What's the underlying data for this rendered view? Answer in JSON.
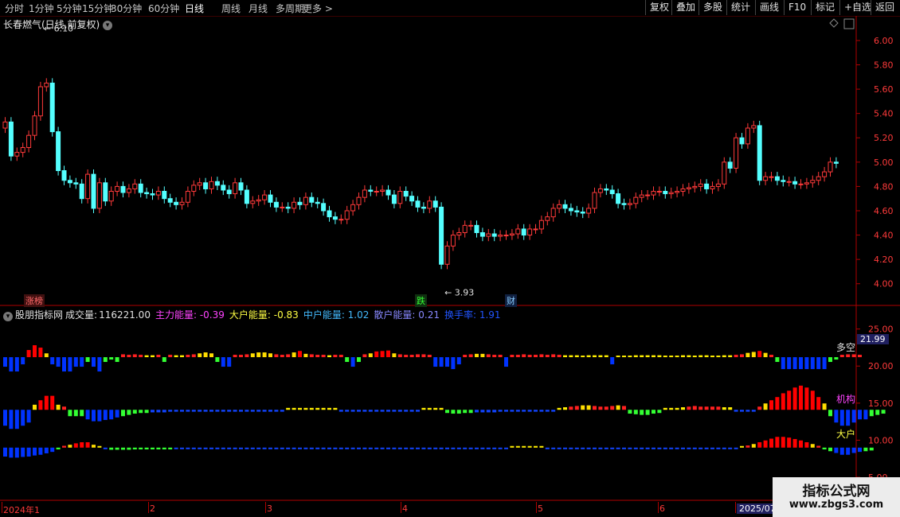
{
  "toolbar": {
    "timeframes": [
      "分时",
      "1分钟",
      "5分钟",
      "15分钟",
      "30分钟",
      "60分钟",
      "日线",
      "周线",
      "月线",
      "多周期",
      "更多 >"
    ],
    "active_timeframe": "日线",
    "buttons": [
      "复权",
      "叠加",
      "多股",
      "统计",
      "画线",
      "F10",
      "标记",
      "+自选",
      "返回"
    ]
  },
  "stock": {
    "title": "长春燃气(日线,前复权)",
    "high_label": "6.10",
    "low_label": "3.93"
  },
  "price_axis": [
    "6.00",
    "5.80",
    "5.60",
    "5.40",
    "5.20",
    "5.00",
    "4.80",
    "4.60",
    "4.40",
    "4.20",
    "4.00"
  ],
  "events": {
    "zhangbang": "涨榜",
    "die": "跌",
    "cai": "财"
  },
  "indicator": {
    "name": "股朋指标网",
    "volume_label": "成交量:",
    "volume_value": "116221.00",
    "main": "主力能量: -0.39",
    "big": "大户能量: -0.83",
    "mid": "中户能量: 1.02",
    "retail": "散户能量: 0.21",
    "turnover": "换手率: 1.91",
    "axis": [
      "25.00",
      "20.00",
      "15.00",
      "10.00",
      "5.00"
    ],
    "current_value": "21.99",
    "lines": {
      "duokong": "多空",
      "jigou": "机构",
      "dahu": "大户"
    }
  },
  "dates": [
    "2024年1",
    "2",
    "3",
    "4",
    "5",
    "6",
    "2025/07"
  ],
  "watermark": {
    "line1": "指标公式网",
    "line2": "www.zbgs3.com"
  },
  "colors": {
    "up": "#ff3a3a",
    "down": "#54ffff",
    "frame": "#b00000"
  },
  "chart_data": {
    "type": "candlestick",
    "price_range": [
      3.9,
      6.15
    ],
    "closes": [
      5.33,
      5.05,
      5.08,
      5.12,
      5.22,
      5.38,
      5.62,
      5.65,
      5.25,
      4.93,
      4.85,
      4.83,
      4.82,
      4.7,
      4.9,
      4.62,
      4.83,
      4.68,
      4.76,
      4.8,
      4.75,
      4.78,
      4.82,
      4.75,
      4.74,
      4.73,
      4.76,
      4.7,
      4.67,
      4.65,
      4.67,
      4.76,
      4.81,
      4.83,
      4.78,
      4.84,
      4.81,
      4.77,
      4.74,
      4.83,
      4.77,
      4.66,
      4.68,
      4.69,
      4.73,
      4.67,
      4.63,
      4.63,
      4.62,
      4.67,
      4.65,
      4.71,
      4.67,
      4.66,
      4.6,
      4.55,
      4.53,
      4.53,
      4.6,
      4.65,
      4.71,
      4.77,
      4.76,
      4.76,
      4.77,
      4.73,
      4.66,
      4.76,
      4.72,
      4.68,
      4.63,
      4.62,
      4.68,
      4.63,
      4.16,
      4.31,
      4.4,
      4.42,
      4.48,
      4.48,
      4.42,
      4.39,
      4.41,
      4.39,
      4.4,
      4.4,
      4.41,
      4.45,
      4.4,
      4.45,
      4.45,
      4.52,
      4.55,
      4.62,
      4.65,
      4.62,
      4.6,
      4.59,
      4.58,
      4.62,
      4.75,
      4.78,
      4.77,
      4.74,
      4.66,
      4.65,
      4.66,
      4.71,
      4.73,
      4.73,
      4.76,
      4.76,
      4.74,
      4.75,
      4.76,
      4.78,
      4.79,
      4.8,
      4.82,
      4.78,
      4.8,
      4.82,
      5.0,
      4.95,
      5.2,
      5.15,
      5.28,
      5.3,
      4.85,
      4.88,
      4.88,
      4.85,
      4.84,
      4.84,
      4.82,
      4.82,
      4.83,
      4.85,
      4.88,
      4.92,
      5.0,
      4.99
    ],
    "volume_bars": {
      "duokong": [
        -2,
        -3,
        -3,
        -1.5,
        1.5,
        2.5,
        2,
        0.8,
        -1.5,
        -2,
        -3,
        -3,
        -2,
        -2,
        -1,
        -2,
        -3,
        -1,
        -0.5,
        -1,
        0.6,
        0.5,
        0.6,
        0.5,
        0.4,
        0.4,
        0.5,
        -1,
        0.5,
        0.4,
        0.4,
        0.5,
        0.6,
        0.8,
        1,
        0.8,
        -1,
        -2,
        -2,
        0.5,
        0.5,
        0.6,
        0.8,
        1,
        1,
        0.8,
        0.6,
        0.5,
        0.6,
        1,
        1.3,
        0.7,
        0.6,
        0.5,
        0.5,
        0.4,
        0.5,
        0.5,
        -1,
        -2,
        -1,
        0.6,
        0.8,
        1.2,
        1.3,
        1.4,
        0.8,
        0.6,
        0.5,
        0.5,
        0.6,
        0.6,
        0.5,
        -2,
        -2,
        -2,
        -2.5,
        -1.5,
        0.5,
        0.6,
        0.7,
        0.7,
        0.6,
        0.5,
        0.5,
        -2,
        0.5,
        0.5,
        0.6,
        0.5,
        0.5,
        0.6,
        0.5,
        0.6,
        0.5,
        0.4,
        0.4,
        0.4,
        0.3,
        0.4,
        0.4,
        0.4,
        0.4,
        -1.5,
        0.3,
        0.3,
        0.3,
        0.4,
        0.4,
        0.4,
        0.4,
        0.4,
        0.3,
        0.3,
        0.3,
        0.4,
        0.4,
        0.3,
        0.4,
        0.4,
        0.3,
        0.3,
        0.4,
        0.4,
        0.5,
        0.6,
        0.9,
        1.1,
        1.3,
        0.9,
        0.5,
        -1,
        -2.5,
        -2.5,
        -2.5,
        -2.5,
        -2.5,
        -2.5,
        -2.5,
        -2.5,
        -1,
        -0.5,
        0.5,
        0.6,
        0.6,
        0.5
      ],
      "jigou": [
        -2.5,
        -3,
        -3,
        -2.5,
        -2,
        0.8,
        1.5,
        2.2,
        2.2,
        0.8,
        0.5,
        -1,
        -1,
        -1,
        -1.5,
        -1.8,
        -1.8,
        -1.6,
        -1.5,
        -1.2,
        -1,
        -0.8,
        -0.6,
        -0.5,
        -0.5,
        -0.4,
        -0.4,
        -0.4,
        -0.3,
        -0.3,
        -0.3,
        -0.3,
        -0.3,
        -0.3,
        -0.3,
        -0.3,
        -0.3,
        -0.3,
        -0.3,
        -0.3,
        -0.3,
        -0.3,
        -0.3,
        -0.3,
        -0.3,
        -0.3,
        -0.3,
        -0.3,
        0.3,
        0.3,
        0.3,
        0.3,
        0.3,
        0.3,
        0.3,
        0.3,
        0.3,
        -0.3,
        -0.3,
        -0.3,
        -0.3,
        -0.3,
        -0.3,
        -0.3,
        -0.3,
        -0.3,
        -0.3,
        -0.3,
        -0.3,
        -0.3,
        -0.3,
        0.3,
        0.3,
        0.3,
        0.3,
        -0.5,
        -0.6,
        -0.6,
        -0.5,
        -0.5,
        -0.4,
        -0.4,
        -0.4,
        -0.4,
        -0.3,
        -0.3,
        -0.3,
        -0.3,
        -0.3,
        -0.3,
        -0.3,
        -0.3,
        -0.3,
        -0.3,
        0.3,
        0.4,
        0.5,
        0.6,
        0.7,
        0.7,
        0.6,
        0.5,
        0.5,
        0.6,
        0.7,
        0.6,
        -0.6,
        -0.7,
        -0.8,
        -0.8,
        -0.6,
        -0.5,
        0.3,
        0.3,
        0.3,
        0.4,
        0.5,
        0.6,
        0.5,
        0.5,
        0.5,
        0.5,
        0.4,
        0.4,
        -0.3,
        -0.3,
        -0.3,
        -0.3,
        0.5,
        1,
        1.5,
        2,
        2.6,
        3,
        3.5,
        3.8,
        3.5,
        3,
        2,
        1,
        -1,
        -2,
        -2.5,
        -2.5,
        -2,
        -1.5,
        -1.5,
        -1,
        -0.8,
        -0.6
      ],
      "dahu": [
        -2.5,
        -2.8,
        -2.8,
        -2.6,
        -2.5,
        -2.2,
        -2,
        -1.6,
        -1.2,
        -0.5,
        0.5,
        0.8,
        1.2,
        1.5,
        1.5,
        0.8,
        0.4,
        -0.4,
        -0.6,
        -0.6,
        -0.6,
        -0.6,
        -0.5,
        -0.5,
        -0.5,
        -0.5,
        -0.5,
        -0.5,
        -0.5,
        -0.4,
        -0.4,
        -0.4,
        -0.4,
        -0.4,
        -0.4,
        -0.4,
        -0.4,
        -0.4,
        -0.4,
        -0.4,
        -0.4,
        -0.4,
        -0.4,
        -0.4,
        -0.4,
        -0.4,
        -0.4,
        -0.4,
        -0.4,
        -0.4,
        -0.4,
        -0.4,
        -0.4,
        -0.4,
        -0.4,
        -0.4,
        -0.3,
        -0.3,
        -0.3,
        -0.3,
        -0.3,
        -0.3,
        -0.3,
        -0.3,
        -0.3,
        -0.3,
        -0.3,
        -0.3,
        -0.3,
        -0.3,
        -0.3,
        -0.3,
        -0.3,
        -0.3,
        -0.3,
        -0.3,
        -0.3,
        -0.3,
        -0.3,
        -0.3,
        -0.3,
        -0.3,
        -0.3,
        -0.3,
        -0.3,
        -0.3,
        0.3,
        0.3,
        0.4,
        0.4,
        0.3,
        0.3,
        -0.3,
        -0.3,
        -0.3,
        -0.3,
        -0.3,
        -0.3,
        -0.3,
        -0.3,
        -0.3,
        -0.3,
        -0.3,
        -0.3,
        -0.3,
        -0.3,
        -0.3,
        -0.3,
        -0.3,
        -0.3,
        -0.3,
        -0.3,
        -0.3,
        -0.3,
        -0.3,
        -0.3,
        -0.3,
        -0.3,
        -0.3,
        -0.3,
        -0.3,
        -0.3,
        -0.3,
        -0.3,
        -0.3,
        0.3,
        0.6,
        1,
        1.5,
        2,
        2.5,
        3,
        3,
        2.8,
        2.4,
        2,
        1.5,
        1,
        0.5,
        -0.5,
        -1,
        -1.5,
        -2,
        -2,
        -1.5,
        -1.2,
        -1,
        -0.8
      ]
    }
  }
}
